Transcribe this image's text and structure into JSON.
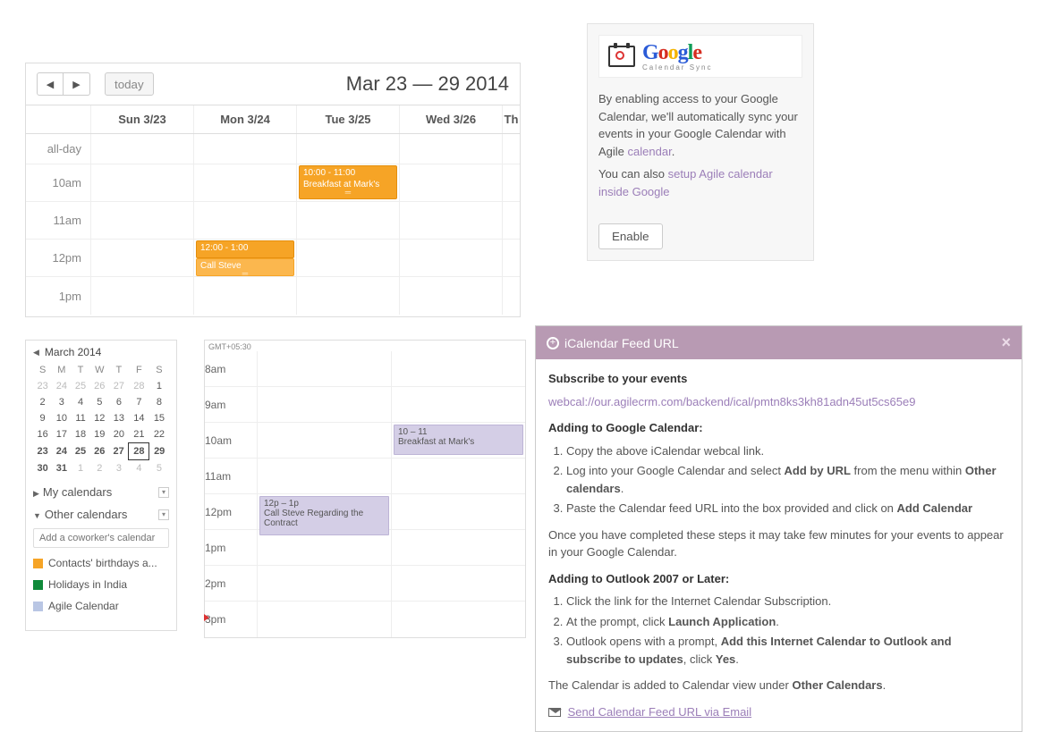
{
  "weekview": {
    "today_label": "today",
    "title": "Mar 23 — 29 2014",
    "days": [
      "Sun 3/23",
      "Mon 3/24",
      "Tue 3/25",
      "Wed 3/26",
      "Th"
    ],
    "allday_label": "all-day",
    "hours": [
      "10am",
      "11am",
      "12pm",
      "1pm"
    ],
    "events": {
      "tue_10": {
        "time": "10:00 - 11:00",
        "title": "Breakfast at Mark's"
      },
      "mon_12": {
        "time": "12:00 - 1:00",
        "title": "Call Steve"
      }
    }
  },
  "minical": {
    "month": "March 2014",
    "dow": [
      "S",
      "M",
      "T",
      "W",
      "T",
      "F",
      "S"
    ],
    "weeks": [
      [
        "23",
        "24",
        "25",
        "26",
        "27",
        "28",
        "1"
      ],
      [
        "2",
        "3",
        "4",
        "5",
        "6",
        "7",
        "8"
      ],
      [
        "9",
        "10",
        "11",
        "12",
        "13",
        "14",
        "15"
      ],
      [
        "16",
        "17",
        "18",
        "19",
        "20",
        "21",
        "22"
      ],
      [
        "23",
        "24",
        "25",
        "26",
        "27",
        "28",
        "29"
      ],
      [
        "30",
        "31",
        "1",
        "2",
        "3",
        "4",
        "5"
      ]
    ],
    "sections": {
      "my": "My calendars",
      "other": "Other calendars"
    },
    "coworker_placeholder": "Add a coworker's calendar",
    "cals": [
      {
        "name": "Contacts' birthdays a...",
        "color": "#f6a426"
      },
      {
        "name": "Holidays in India",
        "color": "#0f8a3a"
      },
      {
        "name": "Agile Calendar",
        "color": "#b9c6e4"
      }
    ]
  },
  "miniweek": {
    "tz": "GMT+05:30",
    "hours": [
      "8am",
      "9am",
      "10am",
      "11am",
      "12pm",
      "1pm",
      "2pm",
      "3pm"
    ],
    "ev10": {
      "time": "10 – 11",
      "title": "Breakfast at Mark's"
    },
    "ev12": {
      "time": "12p – 1p",
      "title": "Call Steve Regarding the Contract"
    }
  },
  "gbox": {
    "word": "Google",
    "sub": "Calendar Sync",
    "p1a": "By enabling access to your Google Calendar, we'll automatically sync your events in your Google Calendar with Agile ",
    "p1_link": "calendar",
    "p1z": ".",
    "p2a": "You can also ",
    "p2_link": "setup Agile calendar inside Google",
    "enable": "Enable"
  },
  "ical": {
    "header": "iCalendar Feed URL",
    "sub_title": "Subscribe to your events",
    "url": "webcal://our.agilecrm.com/backend/ical/pmtn8ks3kh81adn45ut5cs65e9",
    "gc_h": "Adding to Google Calendar:",
    "gc_steps": [
      "Copy the above iCalendar webcal link.",
      "Log into your Google Calendar and select <b>Add by URL</b> from the menu within <b>Other calendars</b>.",
      "Paste the Calendar feed URL into the box provided and click on <b>Add Calendar</b>"
    ],
    "gc_note": "Once you have completed these steps it may take few minutes for your events to appear in your Google Calendar.",
    "ol_h": "Adding to Outlook 2007 or Later:",
    "ol_steps": [
      "Click the link for the Internet Calendar Subscription.",
      "At the prompt, click <b>Launch Application</b>.",
      "Outlook opens with a prompt, <b>Add this Internet Calendar to Outlook and subscribe to updates</b>, click <b>Yes</b>."
    ],
    "ol_note": "The Calendar is added to Calendar view under <b>Other Calendars</b>.",
    "email_link": "Send Calendar Feed URL via Email"
  }
}
